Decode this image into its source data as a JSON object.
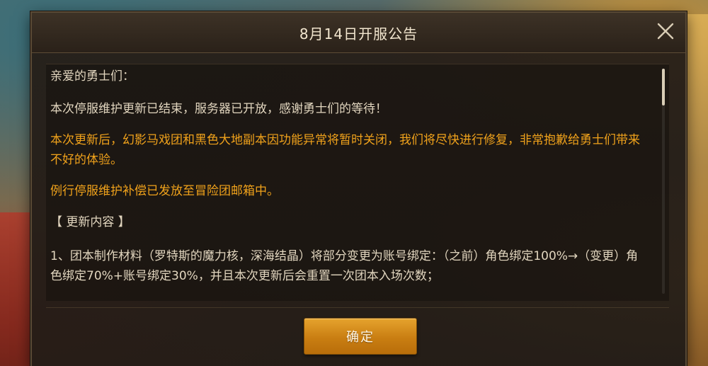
{
  "dialog": {
    "title": "8月14日开服公告",
    "close_icon": "close-icon",
    "confirm_label": "确定"
  },
  "content": {
    "greeting": "亲爱的勇士们：",
    "p1": "本次停服维护更新已结束，服务器已开放，感谢勇士们的等待！",
    "p2": "本次更新后，幻影马戏团和黑色大地副本因功能异常将暂时关闭，我们将尽快进行修复，非常抱歉给勇士们带来不好的体验。",
    "p3": "例行停服维护补偿已发放至冒险团邮箱中。",
    "section_header": "【 更新内容 】",
    "item1": "1、团本制作材料（罗特斯的魔力核，深海结晶）将部分变更为账号绑定：（之前）角色绑定100%→（变更）角色绑定70%+账号绑定30%，并且本次更新后会重置一次团本入场次数；"
  },
  "scroll": {
    "position_fraction": 0.0
  },
  "colors": {
    "highlight": "#f0a21b",
    "text": "#e2d6bf",
    "button": "#d08a1a"
  }
}
